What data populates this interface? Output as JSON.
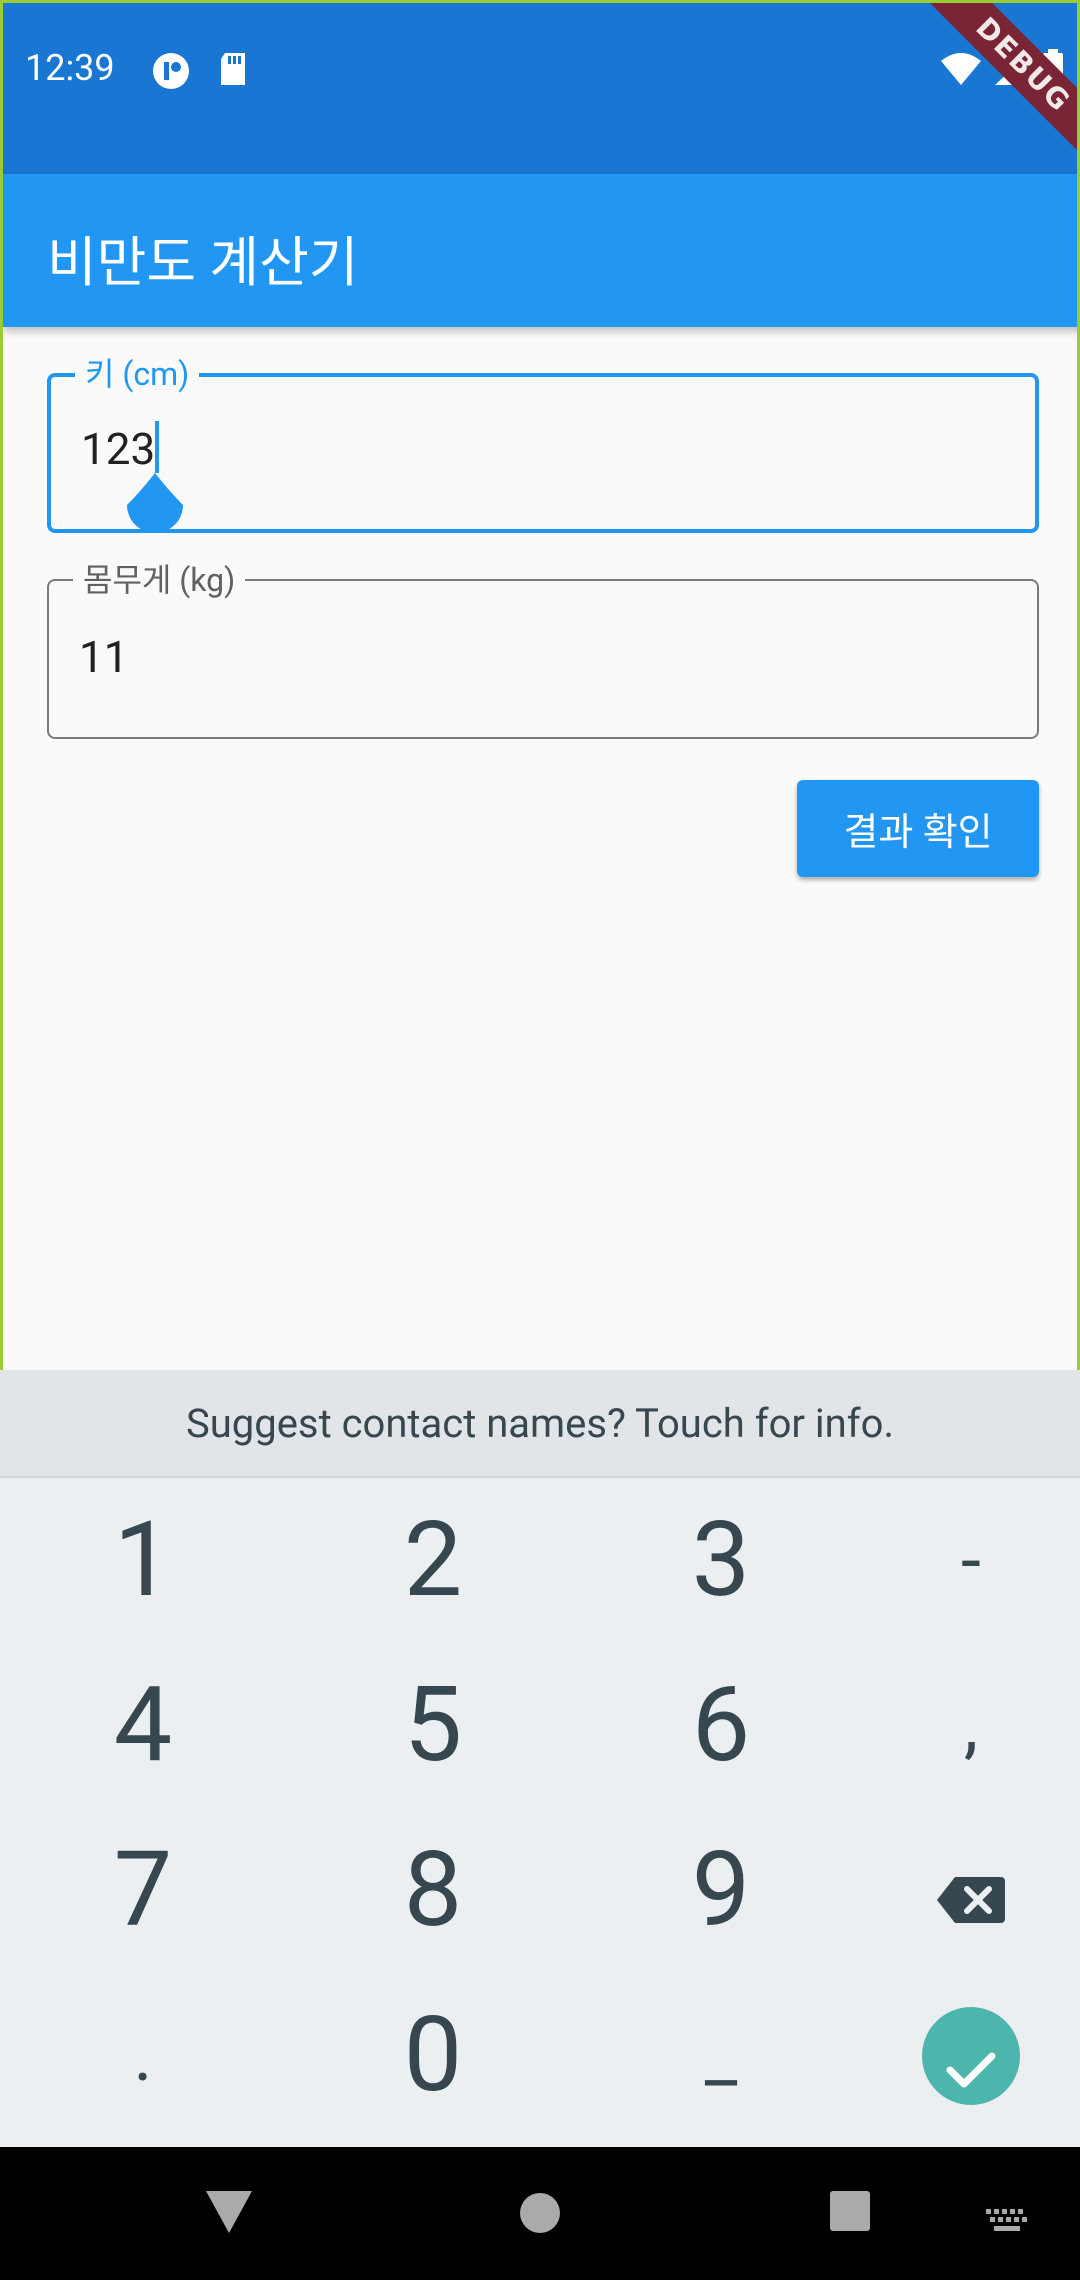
{
  "status_bar": {
    "time": "12:39",
    "icons": [
      "launcher-icon",
      "sd-card-icon",
      "wifi-icon",
      "signal-icon",
      "battery-icon"
    ],
    "debug_banner": "DEBUG"
  },
  "app_bar": {
    "title": "비만도 계산기"
  },
  "form": {
    "height_field": {
      "label": "키 (cm)",
      "value": "123"
    },
    "weight_field": {
      "label": "몸무게 (kg)",
      "value": "11"
    },
    "submit_label": "결과 확인"
  },
  "keyboard": {
    "suggestion": "Suggest contact names? Touch for info.",
    "keys": {
      "k1": "1",
      "k2": "2",
      "k3": "3",
      "dash": "-",
      "k4": "4",
      "k5": "5",
      "k6": "6",
      "comma": ",",
      "k7": "7",
      "k8": "8",
      "k9": "9",
      "period": ".",
      "k0": "0",
      "underscore": "_"
    }
  },
  "colors": {
    "primary": "#2196F3",
    "primary_dark": "#1976D2",
    "enter_key": "#4DB6AC"
  },
  "nav_bar": {
    "buttons": [
      "back-icon",
      "home-icon",
      "recents-icon",
      "keyboard-switch-icon"
    ]
  }
}
